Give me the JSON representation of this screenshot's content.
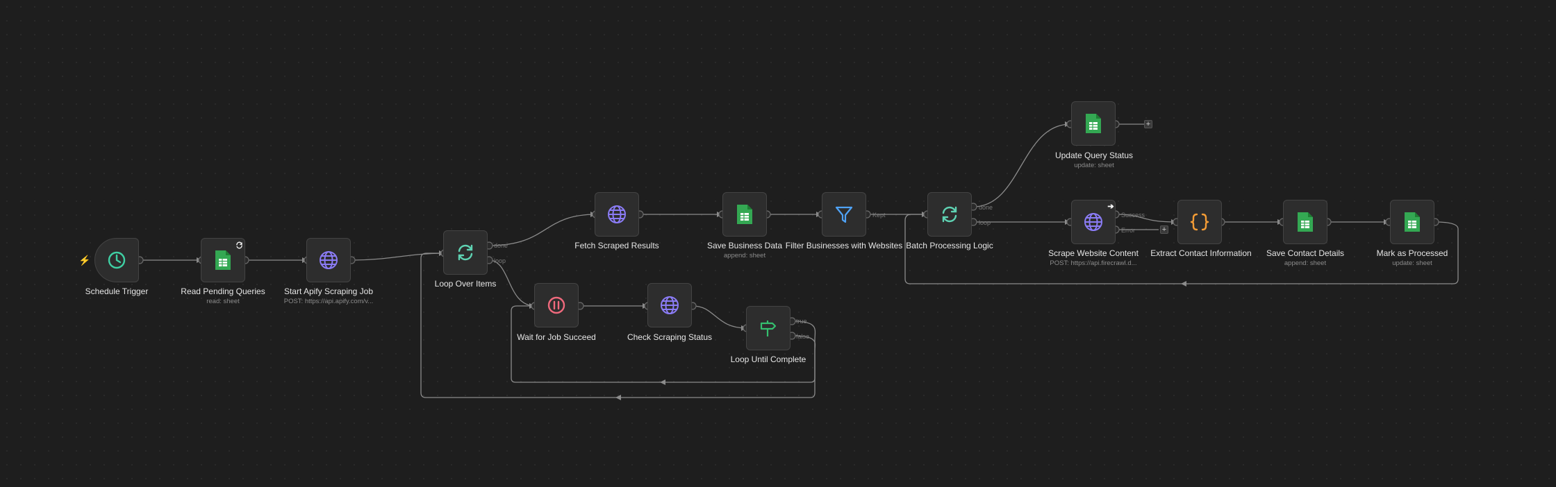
{
  "workflow": {
    "nodes": [
      {
        "id": "schedule",
        "label": "Schedule Trigger",
        "icon": "clock-icon"
      },
      {
        "id": "read",
        "label": "Read Pending Queries",
        "subtitle": "read: sheet",
        "icon": "google-sheets-icon"
      },
      {
        "id": "apify",
        "label": "Start Apify Scraping Job",
        "subtitle": "POST: https://api.apify.com/v...",
        "icon": "globe-icon"
      },
      {
        "id": "loop",
        "label": "Loop Over Items",
        "icon": "loop-icon"
      },
      {
        "id": "fetch",
        "label": "Fetch Scraped Results",
        "icon": "globe-icon"
      },
      {
        "id": "wait",
        "label": "Wait for Job Succeed",
        "icon": "pause-icon"
      },
      {
        "id": "check",
        "label": "Check Scraping Status",
        "icon": "globe-icon"
      },
      {
        "id": "until",
        "label": "Loop Until Complete",
        "icon": "signpost-icon"
      },
      {
        "id": "savebiz",
        "label": "Save Business Data",
        "subtitle": "append: sheet",
        "icon": "google-sheets-icon"
      },
      {
        "id": "filter",
        "label": "Filter Businesses with Websites",
        "icon": "filter-icon"
      },
      {
        "id": "batch",
        "label": "Batch Processing Logic",
        "icon": "loop-icon"
      },
      {
        "id": "update",
        "label": "Update Query Status",
        "subtitle": "update: sheet",
        "icon": "google-sheets-icon"
      },
      {
        "id": "scrape",
        "label": "Scrape Website Content",
        "subtitle": "POST: https://api.firecrawl.d...",
        "icon": "globe-icon"
      },
      {
        "id": "extract",
        "label": "Extract Contact Information",
        "icon": "code-braces-icon"
      },
      {
        "id": "savecontact",
        "label": "Save Contact Details",
        "subtitle": "append: sheet",
        "icon": "google-sheets-icon"
      },
      {
        "id": "mark",
        "label": "Mark as Processed",
        "subtitle": "update: sheet",
        "icon": "google-sheets-icon"
      }
    ],
    "port_labels": {
      "loop_done": "done",
      "loop_loop": "loop",
      "until_true": "true",
      "until_false": "false",
      "filter_kept": "Kept",
      "batch_done": "done",
      "batch_loop": "loop",
      "scrape_success": "Success",
      "scrape_error": "Error"
    },
    "colors": {
      "background": "#1e1e1e",
      "node_fill": "#2d2d2d",
      "wire": "#8c8c8c",
      "clock": "#3fd0a4",
      "sheets": "#34a853",
      "globe": "#8b7cf6",
      "loop": "#5fd3b3",
      "pause": "#f06a7d",
      "signpost": "#35c06f",
      "filter": "#4fa3f7",
      "code": "#f39c36",
      "trigger_bolt": "#ff6d5a"
    }
  }
}
